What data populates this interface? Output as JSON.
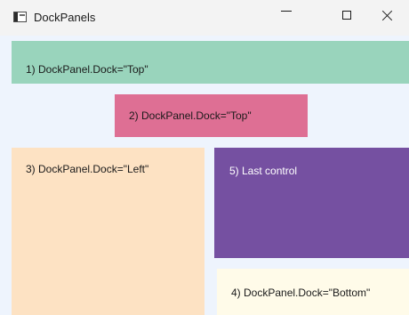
{
  "window": {
    "title": "DockPanels",
    "icon": "window-app-icon",
    "controls": {
      "minimize": "minimize-icon",
      "maximize": "maximize-icon",
      "close": "close-icon"
    }
  },
  "panels": [
    {
      "label": "1) DockPanel.Dock=\"Top\"",
      "color": "#99d4bc"
    },
    {
      "label": "2) DockPanel.Dock=\"Top\"",
      "color": "#de6f94"
    },
    {
      "label": "3) DockPanel.Dock=\"Left\"",
      "color": "#fde2c3"
    },
    {
      "label": "4) DockPanel.Dock=\"Bottom\"",
      "color": "#fffbe9"
    },
    {
      "label": "5) Last control",
      "color": "#7550a1"
    }
  ],
  "client_background": "#eef4fd"
}
